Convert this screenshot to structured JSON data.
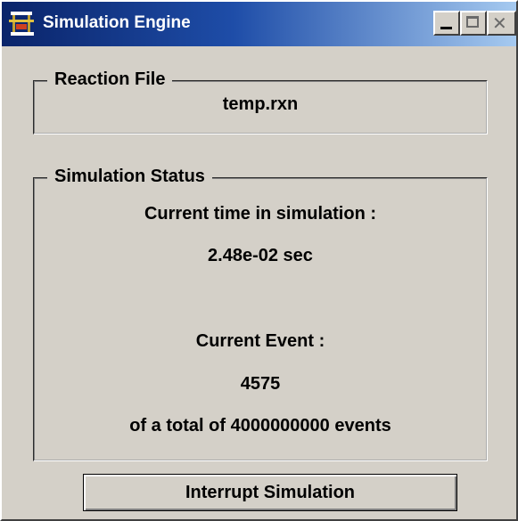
{
  "window": {
    "title": "Simulation Engine",
    "icon": "simulation-app-icon",
    "controls": [
      "minimize",
      "maximize",
      "close"
    ]
  },
  "reaction_file": {
    "legend": "Reaction File",
    "filename": "temp.rxn"
  },
  "simulation_status": {
    "legend": "Simulation Status",
    "time_label": "Current time in simulation :",
    "time_value": "2.48e-02 sec",
    "event_label": "Current Event :",
    "event_value": "4575",
    "event_total": "of a total of 4000000000 events"
  },
  "actions": {
    "interrupt_label": "Interrupt Simulation"
  },
  "colors": {
    "face": "#d4d0c8",
    "title_active_start": "#0a246a",
    "title_active_end": "#a6caf0"
  }
}
